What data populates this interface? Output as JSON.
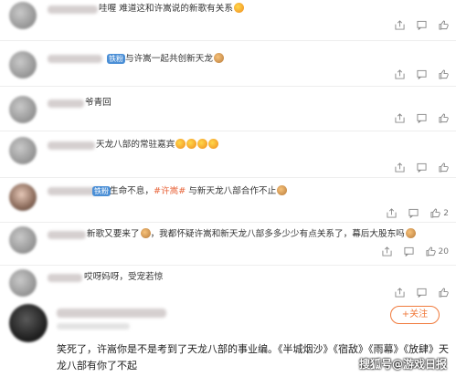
{
  "comments": [
    {
      "badge": "",
      "text_parts": [
        {
          "t": "哇喔  难道这和许嵩说的新歌有关系",
          "tag": false
        }
      ],
      "emojis": [
        "kiss"
      ],
      "count": ""
    },
    {
      "badge": "铁粉",
      "text_parts": [
        {
          "t": "与许嵩一起共创新天龙",
          "tag": false
        }
      ],
      "emojis": [
        "cat"
      ],
      "count": ""
    },
    {
      "badge": "",
      "text_parts": [
        {
          "t": "爷青回",
          "tag": false
        }
      ],
      "emojis": [],
      "count": ""
    },
    {
      "badge": "",
      "text_parts": [
        {
          "t": "天龙八部的常驻嘉宾",
          "tag": false
        }
      ],
      "emojis": [
        "kiss",
        "kiss",
        "kiss",
        "kiss"
      ],
      "count": ""
    },
    {
      "badge": "铁粉",
      "text_parts": [
        {
          "t": "生命不息，",
          "tag": false
        },
        {
          "t": "#许嵩#",
          "tag": true
        },
        {
          "t": " 与新天龙八部合作不止",
          "tag": false
        }
      ],
      "emojis": [
        "cat"
      ],
      "count": "2"
    },
    {
      "badge": "",
      "text_parts": [
        {
          "t": "新歌又要来了",
          "tag": false
        }
      ],
      "emojis": [
        "cat"
      ],
      "text2": "，我都怀疑许嵩和新天龙八部多多少少有点关系了，幕后大股东吗",
      "emojis2": [
        "cat"
      ],
      "count": "20"
    },
    {
      "badge": "",
      "text_parts": [
        {
          "t": "哎呀妈呀，受宠若惊",
          "tag": false
        }
      ],
      "emojis": [],
      "count": ""
    }
  ],
  "follow_label": "+关注",
  "big_comment": "笑死了，许嵩你是不是考到了天龙八部的事业编。《半城烟沙》《宿敌》《雨幕》《放肆》天龙八部有你了不起",
  "watermark": "搜狐号@游戏日报",
  "icons": {
    "share": "share-icon",
    "comment": "comment-icon",
    "like": "like-icon"
  }
}
